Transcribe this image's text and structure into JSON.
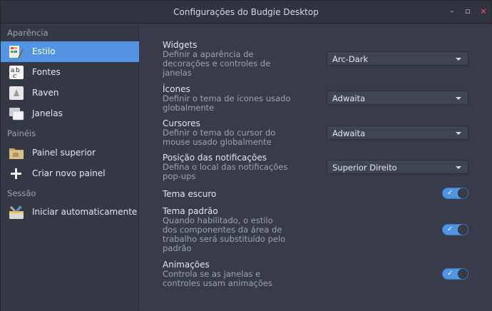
{
  "window": {
    "title": "Configurações do Budgie Desktop"
  },
  "sidebar": {
    "sections": [
      {
        "label": "Aparência"
      },
      {
        "label": "Painéis"
      },
      {
        "label": "Sessão"
      }
    ],
    "items": [
      {
        "label": "Estilo",
        "icon": "style-icon",
        "active": true
      },
      {
        "label": "Fontes",
        "icon": "fonts-icon"
      },
      {
        "label": "Raven",
        "icon": "raven-icon"
      },
      {
        "label": "Janelas",
        "icon": "windows-icon"
      },
      {
        "label": "Painel superior",
        "icon": "panel-icon"
      },
      {
        "label": "Criar novo painel",
        "icon": "add-icon"
      },
      {
        "label": "Iniciar automaticamente",
        "icon": "autostart-icon"
      }
    ]
  },
  "settings": {
    "widgets": {
      "name": "Widgets",
      "desc": "Definir a aparência de decorações e controles de janelas",
      "value": "Arc-Dark"
    },
    "icons": {
      "name": "Ícones",
      "desc": "Definir o tema de ícones usado globalmente",
      "value": "Adwaita"
    },
    "cursors": {
      "name": "Cursores",
      "desc": "Definir o tema do cursor do mouse usado globalmente",
      "value": "Adwaita"
    },
    "notifications": {
      "name": "Posição das notificações",
      "desc": "Defina o local das notificações pop-ups",
      "value": "Superior Direito"
    },
    "dark_theme": {
      "name": "Tema escuro",
      "on": true
    },
    "default_theme": {
      "name": "Tema padrão",
      "desc": "Quando habilitado, o estilo dos componentes da área de trabalho será substituído pelo padrão",
      "on": true
    },
    "animations": {
      "name": "Animações",
      "desc": "Controla se as janelas e controles usam animações",
      "on": true
    }
  },
  "colors": {
    "accent": "#5294e2",
    "bg": "#383c4a",
    "sidebar": "#353946",
    "titlebar": "#2f343f"
  }
}
